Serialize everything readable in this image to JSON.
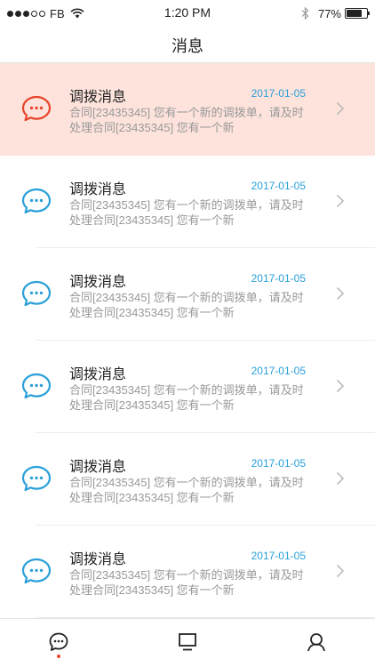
{
  "status_bar": {
    "carrier": "FB",
    "time": "1:20 PM",
    "battery_percent": "77%",
    "battery_level": 0.77,
    "signal_bars": 3,
    "icons": [
      "signal-dots-icon",
      "wifi-icon",
      "bluetooth-icon",
      "battery-icon"
    ]
  },
  "nav": {
    "title": "消息"
  },
  "messages": [
    {
      "title": "调拨消息",
      "date": "2017-01-05",
      "body": "合同[23435345] 您有一个新的调拨单，请及时处理合同[23435345] 您有一个新",
      "icon": "chat-bubble-icon",
      "icon_color": "#e8442b",
      "highlighted": true
    },
    {
      "title": "调拨消息",
      "date": "2017-01-05",
      "body": "合同[23435345] 您有一个新的调拨单，请及时处理合同[23435345] 您有一个新",
      "icon": "chat-bubble-icon",
      "icon_color": "#2aa0d9",
      "highlighted": false
    },
    {
      "title": "调拨消息",
      "date": "2017-01-05",
      "body": "合同[23435345] 您有一个新的调拨单，请及时处理合同[23435345] 您有一个新",
      "icon": "chat-bubble-icon",
      "icon_color": "#2aa0d9",
      "highlighted": false
    },
    {
      "title": "调拨消息",
      "date": "2017-01-05",
      "body": "合同[23435345] 您有一个新的调拨单，请及时处理合同[23435345] 您有一个新",
      "icon": "chat-bubble-icon",
      "icon_color": "#2aa0d9",
      "highlighted": false
    },
    {
      "title": "调拨消息",
      "date": "2017-01-05",
      "body": "合同[23435345] 您有一个新的调拨单，请及时处理合同[23435345] 您有一个新",
      "icon": "chat-bubble-icon",
      "icon_color": "#2aa0d9",
      "highlighted": false
    },
    {
      "title": "调拨消息",
      "date": "2017-01-05",
      "body": "合同[23435345] 您有一个新的调拨单，请及时处理合同[23435345] 您有一个新",
      "icon": "chat-bubble-icon",
      "icon_color": "#2aa0d9",
      "highlighted": false
    }
  ],
  "tab_bar": {
    "tabs": [
      {
        "icon": "message-icon",
        "active": true
      },
      {
        "icon": "monitor-icon",
        "active": false
      },
      {
        "icon": "profile-icon",
        "active": false
      }
    ],
    "active_indicator_color": "#e8442b"
  },
  "colors": {
    "accent_blue": "#2aa0d9",
    "accent_red": "#e8442b",
    "highlight_bg": "#fde3dc",
    "body_text": "#999999"
  }
}
